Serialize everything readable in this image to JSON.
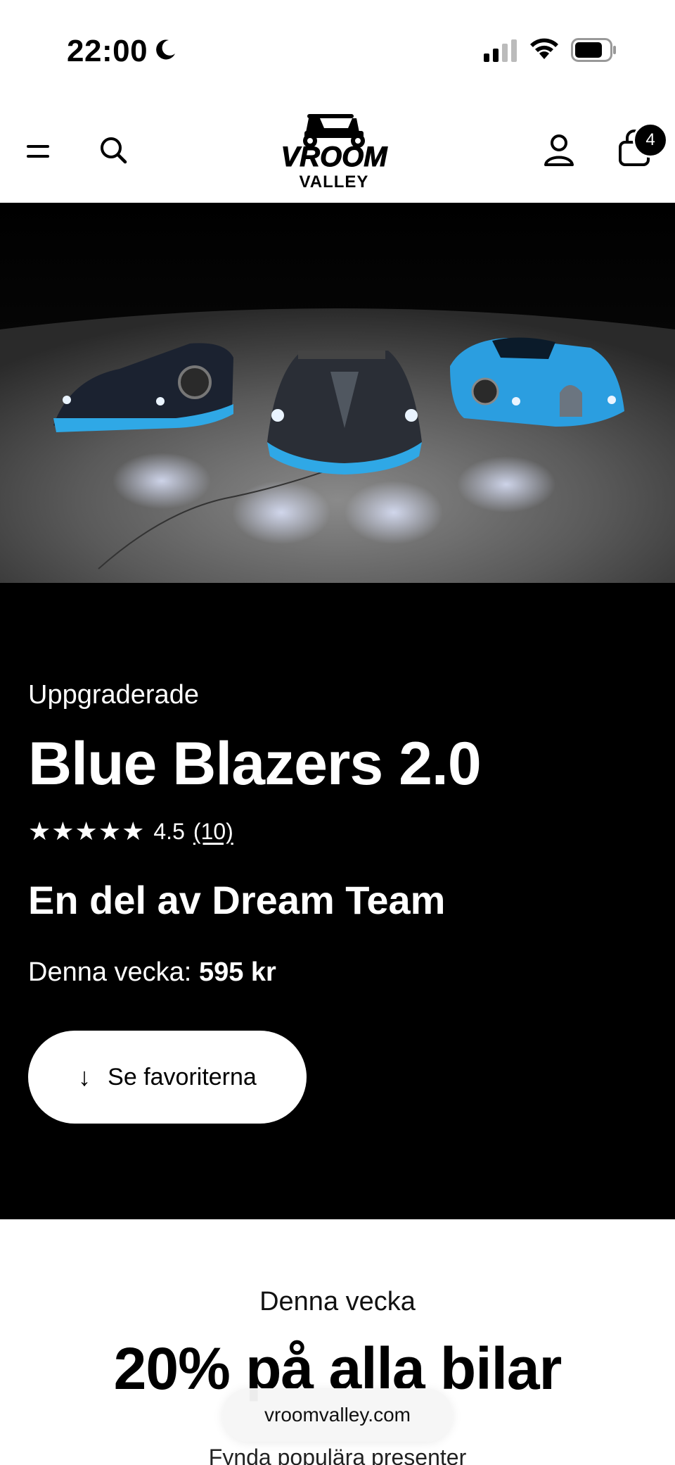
{
  "status_bar": {
    "time": "22:00",
    "focus_icon": "moon-icon",
    "signal_icon": "cellular-signal-icon",
    "wifi_icon": "wifi-icon",
    "battery_icon": "battery-icon"
  },
  "header": {
    "menu_icon": "hamburger-menu-icon",
    "search_icon": "search-icon",
    "logo_text_top": "VROOM",
    "logo_text_bottom": "VALLEY",
    "account_icon": "account-icon",
    "cart_icon": "shopping-bag-icon",
    "cart_count": "4"
  },
  "hero": {
    "eyebrow": "Uppgraderade",
    "title": "Blue Blazers 2.0",
    "rating": {
      "stars": "★★★★★",
      "score": "4.5",
      "count": "(10)",
      "value": 4.5,
      "max": 5
    },
    "subtitle": "En del av Dream Team",
    "price_label": "Denna vecka:",
    "price_value": "595 kr",
    "cta_label": "Se favoriterna",
    "cta_icon": "arrow-down-icon"
  },
  "promo": {
    "eyebrow": "Denna vecka",
    "title": "20% på alla bilar",
    "subtitle": "Fynda populära presenter"
  },
  "browser": {
    "url": "vroomvalley.com"
  },
  "colors": {
    "hero_bg": "#000000",
    "accent_blue": "#2fa8e6",
    "text_light": "#ffffff"
  }
}
